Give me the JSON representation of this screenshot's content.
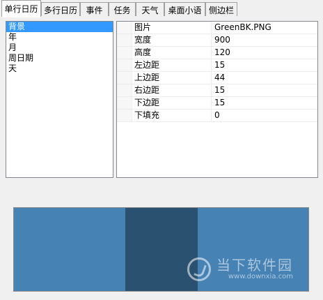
{
  "tabs": [
    {
      "label": "单行日历",
      "active": true
    },
    {
      "label": "多行日历",
      "active": false
    },
    {
      "label": "事件",
      "active": false
    },
    {
      "label": "任务",
      "active": false
    },
    {
      "label": "天气",
      "active": false
    },
    {
      "label": "桌面小语",
      "active": false
    },
    {
      "label": "侧边栏",
      "active": false
    }
  ],
  "list": {
    "items": [
      "背景",
      "年",
      "月",
      "周日期",
      "天"
    ],
    "selected": "背景"
  },
  "properties": [
    {
      "name": "图片",
      "value": "GreenBK.PNG"
    },
    {
      "name": "宽度",
      "value": "900"
    },
    {
      "name": "高度",
      "value": "120"
    },
    {
      "name": "左边距",
      "value": "15"
    },
    {
      "name": "上边距",
      "value": "44"
    },
    {
      "name": "右边距",
      "value": "15"
    },
    {
      "name": "下边距",
      "value": "15"
    },
    {
      "name": "下填充",
      "value": "0"
    }
  ],
  "preview": {
    "outer_color": "#4682b4",
    "center_color": "#2b5170"
  },
  "watermark": {
    "title": "当下软件园",
    "url": "www.downxia.com"
  }
}
